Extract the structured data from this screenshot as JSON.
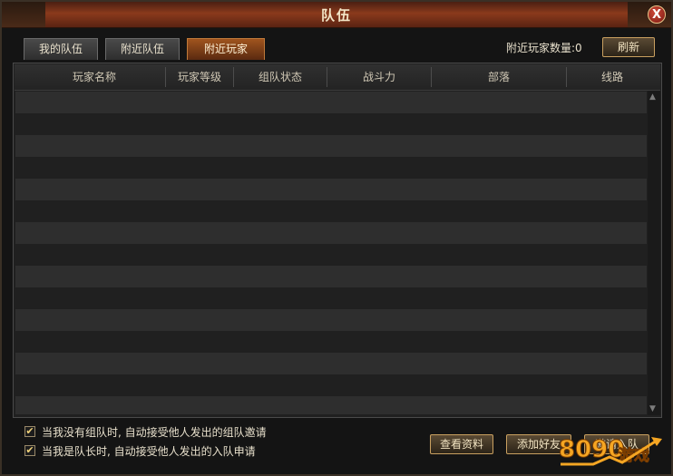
{
  "window": {
    "title": "队伍",
    "close_label": "X"
  },
  "tabs": [
    {
      "label": "我的队伍",
      "active": false
    },
    {
      "label": "附近队伍",
      "active": false
    },
    {
      "label": "附近玩家",
      "active": true
    }
  ],
  "nearby": {
    "count_label": "附近玩家数量:0",
    "refresh_label": "刷新"
  },
  "table": {
    "columns": [
      "玩家名称",
      "玩家等级",
      "组队状态",
      "战斗力",
      "部落",
      "线路"
    ],
    "rows": []
  },
  "options": [
    {
      "label": "当我没有组队时, 自动接受他人发出的组队邀请",
      "checked": true
    },
    {
      "label": "当我是队长时, 自动接受他人发出的入队申请",
      "checked": true
    }
  ],
  "actions": {
    "view_profile": "查看资料",
    "add_friend": "添加好友",
    "invite_team": "邀请入队"
  },
  "watermark": {
    "number": "8090",
    "text": "游戏"
  },
  "colors": {
    "title_bar": "#8a3a1c",
    "active_tab": "#a0541e",
    "button_border": "#c9a060",
    "check": "#f0d27a"
  }
}
